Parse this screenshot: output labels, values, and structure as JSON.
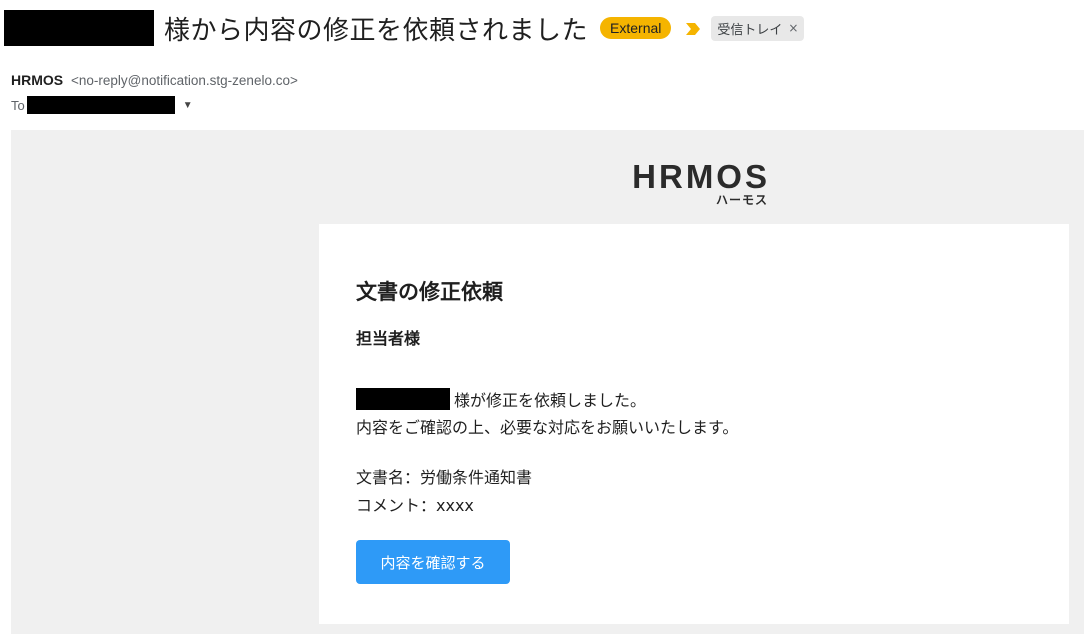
{
  "subject": {
    "text": "様から内容の修正を依頼されました",
    "external_badge": "External",
    "label": "受信トレイ",
    "label_remove": "×"
  },
  "sender": {
    "name": "HRMOS",
    "email": "<no-reply@notification.stg-zenelo.co>",
    "to_label": "To",
    "details_caret": "▼"
  },
  "logo": {
    "main": "HRMOS",
    "sub": "ハーモス"
  },
  "card": {
    "title": "文書の修正依頼",
    "greeting": "担当者様",
    "line1_suffix": "様が修正を依頼しました。",
    "line2": "内容をご確認の上、必要な対応をお願いいたします。",
    "document_name": "文書名：労働条件通知書",
    "comment": "コメント：xxxx",
    "button_label": "内容を確認する"
  },
  "colors": {
    "external_badge": "#f5b400",
    "button": "#2e9af7",
    "importance_marker": "#f5b400",
    "mail_background": "#f0f0f0"
  },
  "icons": {
    "importance": "importance-marker-icon",
    "caret": "chevron-down-icon"
  }
}
